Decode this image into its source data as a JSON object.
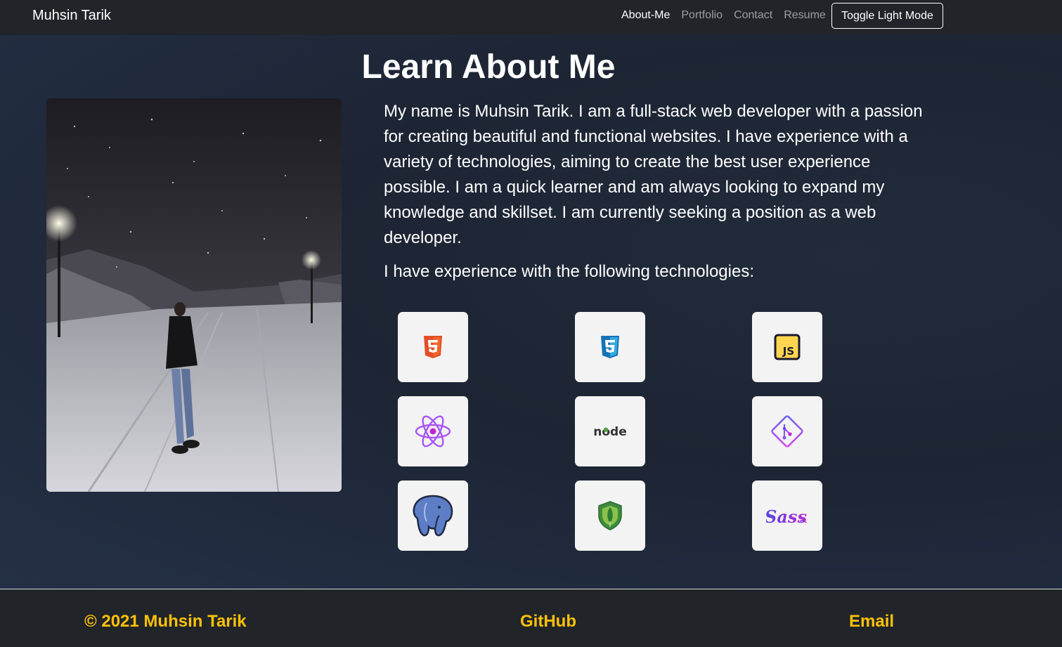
{
  "navbar": {
    "brand": "Muhsin Tarik",
    "links": [
      {
        "label": "About-Me",
        "active": true
      },
      {
        "label": "Portfolio",
        "active": false
      },
      {
        "label": "Contact",
        "active": false
      },
      {
        "label": "Resume",
        "active": false
      }
    ],
    "toggle_label": "Toggle Light Mode"
  },
  "main": {
    "title": "Learn About Me",
    "bio": "My name is Muhsin Tarik. I am a full-stack web developer with a passion for creating beautiful and functional websites. I have experience with a variety of technologies, aiming to create the best user experience possible. I am a quick learner and am always looking to expand my knowledge and skillset. I am currently seeking a position as a web developer.",
    "tech_intro": "I have experience with the following technologies:",
    "technologies": [
      {
        "icon": "html5-icon"
      },
      {
        "icon": "css3-icon"
      },
      {
        "icon": "javascript-icon"
      },
      {
        "icon": "react-icon"
      },
      {
        "icon": "nodejs-icon"
      },
      {
        "icon": "git-icon"
      },
      {
        "icon": "postgresql-icon"
      },
      {
        "icon": "mongodb-icon"
      },
      {
        "icon": "sass-icon"
      }
    ]
  },
  "footer": {
    "copyright": "© 2021 Muhsin Tarik",
    "github": "GitHub",
    "email": "Email"
  },
  "colors": {
    "navbar_bg": "#212529",
    "footer_link": "#ffc107",
    "tile_bg": "#f3f3f3"
  }
}
